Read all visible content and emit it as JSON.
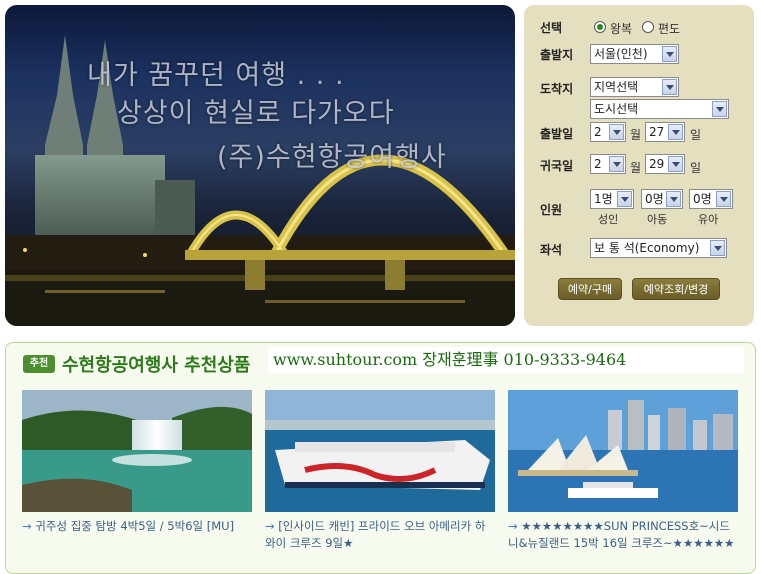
{
  "hero": {
    "line1": "내가 꿈꾸던 여행 . . .",
    "line2": "상상이 현실로 다가오다",
    "line3": "(주)수현항공여행사"
  },
  "booking": {
    "type_label": "선택",
    "type_options": [
      "왕복",
      "편도"
    ],
    "type_selected": "왕복",
    "depart_label": "출발지",
    "depart_value": "서울(인천)",
    "dest_label": "도착지",
    "dest_region": "지역선택",
    "dest_city": "도시선택",
    "out_label": "출발일",
    "out_month": "2",
    "out_day": "27",
    "ret_label": "귀국일",
    "ret_month": "2",
    "ret_day": "29",
    "month_unit": "월",
    "day_unit": "일",
    "pax_label": "인원",
    "adult_value": "1명",
    "child_value": "0명",
    "infant_value": "0명",
    "adult_label": "성인",
    "child_label": "아동",
    "infant_label": "유아",
    "seat_label": "좌석",
    "seat_value": "보 통 석(Economy)",
    "reserve_button": "예약/구매",
    "lookup_button": "예약조회/변경"
  },
  "recommend": {
    "badge": "추천",
    "title": "수현항공여행사 추천상품",
    "contact": "www.suhtour.com 장재훈理事 010-9333-9464",
    "products": [
      {
        "text": "귀주성 집중 탐방 4박5일 / 5박6일 [MU]"
      },
      {
        "text": "[인사이드 캐빈] 프라이드 오브 아메리카 하와이 크루즈 9일★"
      },
      {
        "text": "★★★★★★★★SUN PRINCESS호~시드니&뉴질랜드 15박 16일 크루즈~★★★★★★"
      }
    ]
  }
}
